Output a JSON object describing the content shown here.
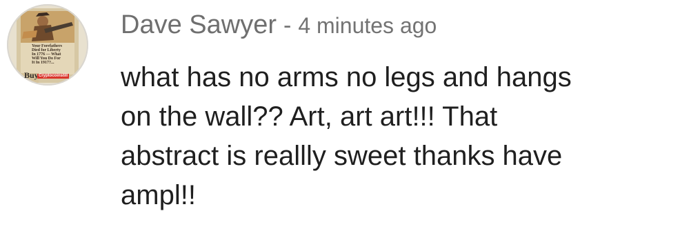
{
  "comment": {
    "author": "Dave Sawyer",
    "separator": "-",
    "timestamp": "4 minutes ago",
    "text": "what has no arms no legs and hangs\non the wall?? Art, art art!!! That\nabstract is reallly sweet thanks have\nampl!!",
    "avatar": {
      "poster_text": "Your Forefathers\nDied for Liberty\nIn 1776 — What\nWill You Do For\nIt In 1917?...",
      "buy_text": "Buy",
      "watermark": "Cryptocoinstill"
    }
  },
  "colors": {
    "author_color": "#6f6f6f",
    "meta_color": "#737373",
    "body_color": "#1f1f1f",
    "background": "#ffffff"
  }
}
